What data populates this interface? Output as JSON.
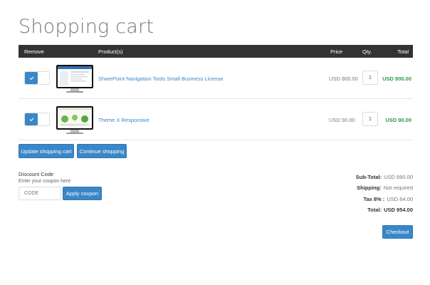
{
  "page": {
    "title": "Shopping cart"
  },
  "table": {
    "headers": {
      "remove": "Remove",
      "product": "Product(s)",
      "price": "Price",
      "qty": "Qty.",
      "total": "Total"
    },
    "rows": [
      {
        "name": "SharePoint Navigation Tools Small Business License",
        "price": "USD 800.00",
        "qty": "1",
        "total": "USD 800.00",
        "checked": true
      },
      {
        "name": "Theme X Responsive",
        "price": "USD 90.00",
        "qty": "1",
        "total": "USD 90.00",
        "checked": true
      }
    ]
  },
  "actions": {
    "update": "Update shopping cart",
    "continue": "Continue shopping",
    "checkout": "Checkout"
  },
  "discount": {
    "title": "Discount Code",
    "subtitle": "Enter your coupon here",
    "placeholder": "CODE",
    "apply": "Apply coupon"
  },
  "summary": {
    "subtotal_label": "Sub-Total:",
    "subtotal": "USD 890.00",
    "shipping_label": "Shipping:",
    "shipping": "Not required",
    "tax_label": "Tax 8% :",
    "tax": "USD 64.00",
    "total_label": "Total:",
    "total": "USD 954.00"
  },
  "colors": {
    "accent": "#3a87c8",
    "header_bg": "#333333",
    "total_green": "#2e9a44"
  },
  "icons": {
    "checkbox": "check-icon"
  }
}
